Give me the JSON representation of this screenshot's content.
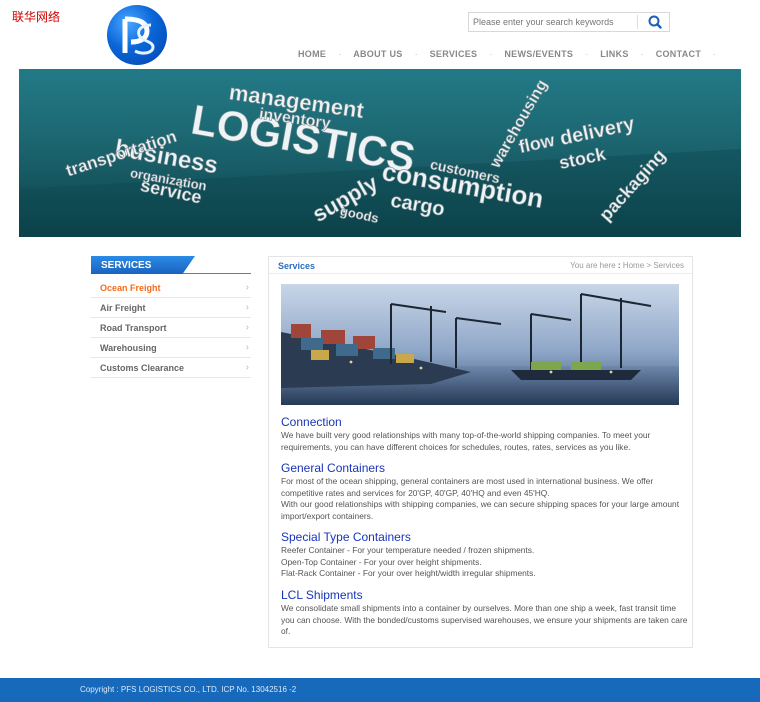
{
  "header": {
    "corner_text": "联华网络",
    "search": {
      "placeholder": "Please enter your search keywords"
    },
    "nav": [
      "HOME",
      "ABOUT US",
      "SERVICES",
      "NEWS/EVENTS",
      "LINKS",
      "CONTACT"
    ]
  },
  "banner": {
    "words": [
      "LOGISTICS",
      "business",
      "management",
      "inventory",
      "supply",
      "consumption",
      "cargo",
      "customers",
      "goods",
      "delivery",
      "stock",
      "flow",
      "packaging",
      "warehousing",
      "organization",
      "transportation",
      "service"
    ]
  },
  "sidebar": {
    "title": "SERVICES",
    "items": [
      {
        "label": "Ocean Freight",
        "active": true
      },
      {
        "label": "Air Freight",
        "active": false
      },
      {
        "label": "Road Transport",
        "active": false
      },
      {
        "label": "Warehousing",
        "active": false
      },
      {
        "label": "Customs Clearance",
        "active": false
      }
    ]
  },
  "content": {
    "title": "Services",
    "breadcrumb": {
      "prefix": "You are here",
      "sep": ":",
      "home": "Home",
      "arrow": ">",
      "current": "Services"
    },
    "sections": [
      {
        "heading": "Connection",
        "lines": [
          "We have built very good relationships with many top-of-the-world shipping companies. To meet your requirements, you can have different choices for schedules, routes, rates, services as you like."
        ]
      },
      {
        "heading": "General Containers",
        "lines": [
          "For most of the ocean shipping, general containers are most used in international business. We offer competitive rates and services for 20'GP, 40'GP, 40'HQ and even 45'HQ.",
          "With our good relationships with shipping companies, we can secure shipping spaces for your large amount import/export containers."
        ]
      },
      {
        "heading": "Special Type Containers",
        "lines": [
          "Reefer Container - For your temperature needed / frozen shipments.",
          "Open-Top Container - For your over height shipments.",
          "Flat-Rack Container - For your over height/width irregular shipments."
        ]
      },
      {
        "heading": "LCL Shipments",
        "lines": [
          "We consolidate small shipments into a container by ourselves. More than one ship a week, fast transit time you can choose. With the bonded/customs supervised warehouses, we ensure your shipments are taken care of."
        ]
      }
    ]
  },
  "footer": {
    "copyright": "Copyright : PFS LOGISTICS CO., LTD. ICP No. 13042516 -2"
  },
  "colors": {
    "brand_blue": "#1769bb",
    "active_orange": "#f26b1d",
    "heading_blue": "#1835b8",
    "banner_teal": "#1a6c78"
  }
}
